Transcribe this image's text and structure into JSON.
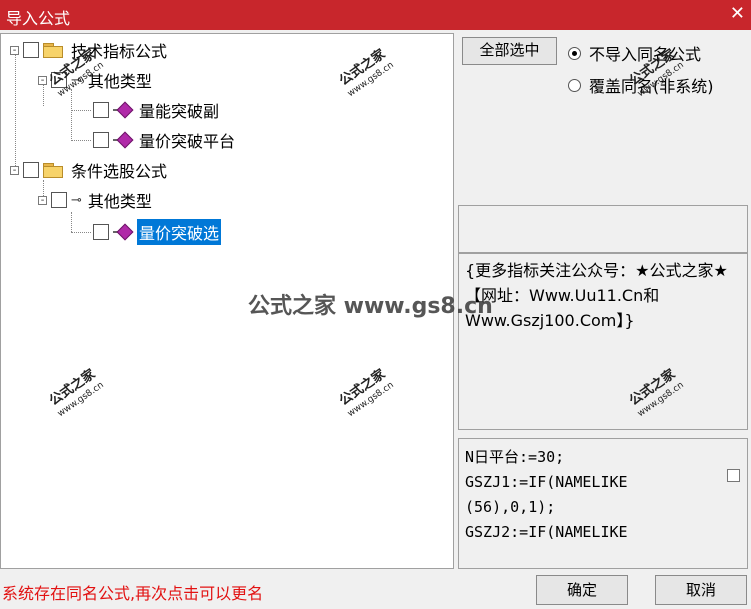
{
  "window": {
    "title": "导入公式",
    "close_icon": "✕"
  },
  "tree": {
    "nodes": [
      {
        "label": "技术指标公式",
        "icon": "folder-icon",
        "expander": "-"
      },
      {
        "label": "其他类型",
        "icon": "key-icon",
        "expander": "-"
      },
      {
        "label": "量能突破副",
        "icon": "formula-icon"
      },
      {
        "label": "量价突破平台",
        "icon": "formula-icon"
      },
      {
        "label": "条件选股公式",
        "icon": "folder-icon",
        "expander": "-"
      },
      {
        "label": "其他类型",
        "icon": "key-icon",
        "expander": "-"
      },
      {
        "label": "量价突破选",
        "icon": "formula-icon",
        "selected": true
      }
    ]
  },
  "options": {
    "select_all_label": "全部选中",
    "radio_no_import": "不导入同名公式",
    "radio_overwrite": "覆盖同名(非系统)",
    "selected_radio": "no_import"
  },
  "description": "{更多指标关注公众号：★公式之家★ 【网址：Www.Uu11.Cn和Www.Gszj100.Com】}",
  "code_lines": [
    "N日平台:=30;",
    "GSZJ1:=IF(NAMELIKE",
    "(56),0,1);",
    "GSZJ2:=IF(NAMELIKE"
  ],
  "status_message": "系统存在同名公式,再次点击可以更名",
  "buttons": {
    "ok": "确定",
    "cancel": "取消"
  },
  "watermark": {
    "text": "公式之家",
    "url": "www.gs8.cn",
    "banner": "公式之家 www.gs8.cn"
  },
  "colors": {
    "titlebar": "#c8262c",
    "status_text": "#e21212",
    "selection": "#0078d7"
  }
}
